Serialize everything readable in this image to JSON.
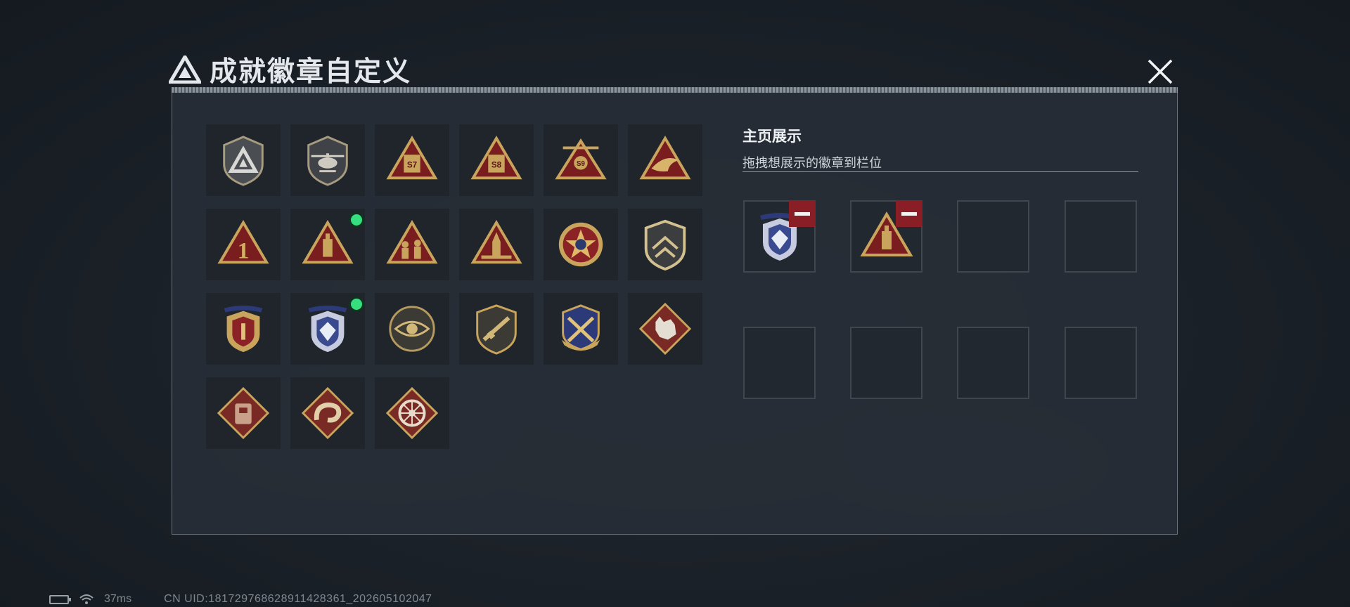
{
  "header": {
    "title": "成就徽章自定义",
    "logo_icon": "triangle-logo-icon",
    "close_icon": "close-icon"
  },
  "badges": [
    {
      "id": "badge-shield-logo",
      "icon": "grey-shield-triangle-icon",
      "new": false
    },
    {
      "id": "badge-helicopter",
      "icon": "helicopter-shield-icon",
      "new": false
    },
    {
      "id": "badge-s7",
      "icon": "s7-triangle-icon",
      "label": "S7",
      "new": false
    },
    {
      "id": "badge-s8",
      "icon": "s8-triangle-icon",
      "label": "S8",
      "new": false
    },
    {
      "id": "badge-s9",
      "icon": "s9-triangle-icon",
      "label": "S9",
      "new": false
    },
    {
      "id": "badge-wing",
      "icon": "wing-triangle-icon",
      "new": false
    },
    {
      "id": "badge-number-one",
      "icon": "number-one-triangle-icon",
      "label": "1",
      "new": false
    },
    {
      "id": "badge-tower",
      "icon": "tower-triangle-icon",
      "new": true
    },
    {
      "id": "badge-soldiers",
      "icon": "soldiers-triangle-icon",
      "new": false
    },
    {
      "id": "badge-rocket",
      "icon": "rocket-triangle-icon",
      "new": false
    },
    {
      "id": "badge-star-medal",
      "icon": "red-star-medal-icon",
      "new": false
    },
    {
      "id": "badge-chevron-shield",
      "icon": "chevron-shield-icon",
      "new": false
    },
    {
      "id": "badge-gold-crest",
      "icon": "gold-crest-icon",
      "new": false
    },
    {
      "id": "badge-diamond-crest",
      "icon": "diamond-crest-icon",
      "new": true
    },
    {
      "id": "badge-eye",
      "icon": "eye-emblem-icon",
      "new": false
    },
    {
      "id": "badge-rifle-shield",
      "icon": "rifle-shield-icon",
      "new": false
    },
    {
      "id": "badge-crossed-shield",
      "icon": "crossed-weapons-crest-icon",
      "new": false
    },
    {
      "id": "badge-wolf",
      "icon": "wolf-diamond-icon",
      "new": false
    },
    {
      "id": "badge-vest",
      "icon": "vest-diamond-icon",
      "new": false
    },
    {
      "id": "badge-snake",
      "icon": "snake-diamond-icon",
      "new": false
    },
    {
      "id": "badge-wheel",
      "icon": "wheel-diamond-icon",
      "new": false
    }
  ],
  "display": {
    "title": "主页展示",
    "subtitle": "拖拽想展示的徽章到栏位",
    "slots": [
      {
        "badge": "diamond-crest-icon",
        "removable": true
      },
      {
        "badge": "tower-triangle-icon",
        "removable": true
      },
      {
        "badge": null
      },
      {
        "badge": null
      },
      {
        "badge": null
      },
      {
        "badge": null
      },
      {
        "badge": null
      },
      {
        "badge": null
      }
    ]
  },
  "status": {
    "ping": "37ms",
    "uid": "CN UID:18172976862891142836​1_202605102047"
  },
  "colors": {
    "panel_bg": "#272e36",
    "gold": "#c9a45c",
    "badge_red": "#7a1d1f",
    "remove_red": "#8a1e27",
    "new_dot": "#36e07e"
  }
}
